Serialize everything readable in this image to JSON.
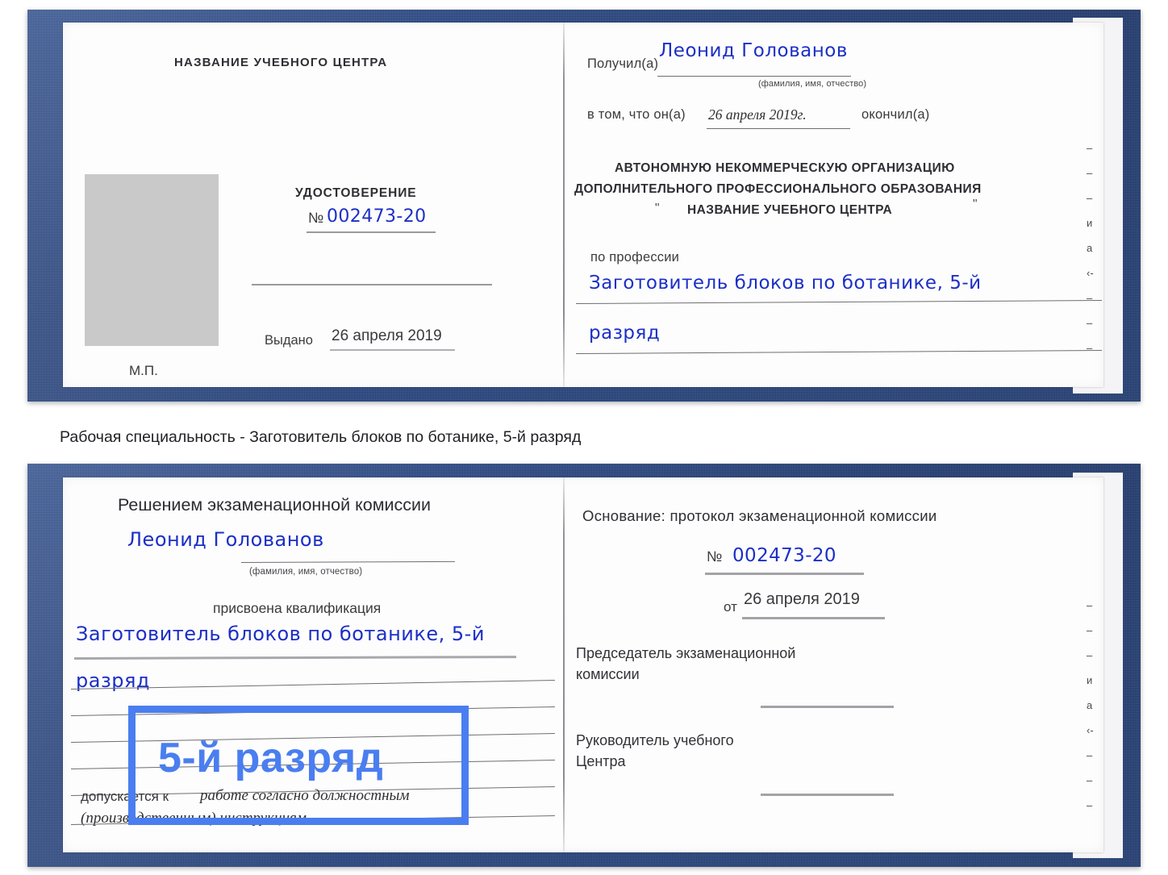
{
  "caption": "Рабочая специальность - Заготовитель блоков по ботанике, 5-й разряд",
  "highlight": {
    "text": "5-й разряд",
    "color": "#4a7ef0"
  },
  "colors": {
    "cover_blue": "#24468a",
    "ink_blue": "#1c2fc6",
    "accent_blue": "#4a7ef0",
    "photo_gray": "#c9c9c9",
    "rule_gray": "#9a9a9e"
  },
  "certificate_top": {
    "left_page": {
      "heading": "НАЗВАНИЕ УЧЕБНОГО ЦЕНТРА",
      "doc_type": "УДОСТОВЕРЕНИЕ",
      "number_symbol": "№",
      "number_value": "002473-20",
      "issued_label": "Выдано",
      "issued_value": "26 апреля 2019",
      "stamp_label": "М.П.",
      "photo_placeholder": "photo-placeholder"
    },
    "right_page": {
      "received_label": "Получил(а)",
      "received_value": "Леонид Голованов",
      "fio_hint": "(фамилия, имя, отчество)",
      "that_label": "в том, что он(а)",
      "that_value": "26 апреля 2019г.",
      "finished_label": "окончил(а)",
      "org_line1": "АВТОНОМНУЮ НЕКОММЕРЧЕСКУЮ ОРГАНИЗАЦИЮ",
      "org_line2": "ДОПОЛНИТЕЛЬНОГО ПРОФЕССИОНАЛЬНОГО ОБРАЗОВАНИЯ",
      "org_quote_open": "\"",
      "org_line3": "НАЗВАНИЕ УЧЕБНОГО ЦЕНТРА",
      "org_quote_close": "\"",
      "profession_label": "по профессии",
      "profession_value_line1": "Заготовитель блоков по ботанике, 5-й",
      "profession_value_line2": "разряд"
    }
  },
  "certificate_bottom": {
    "left_page": {
      "heading": "Решением экзаменационной комиссии",
      "name_value": "Леонид Голованов",
      "fio_hint": "(фамилия, имя, отчество)",
      "qualification_label": "присвоена квалификация",
      "qualification_line1": "Заготовитель блоков по ботанике, 5-й",
      "qualification_line2": "разряд",
      "admit_label": "допускается к",
      "admit_value_line1": "работе согласно должностным",
      "admit_value_line2": "(производственным) инструкциям"
    },
    "right_page": {
      "basis_label": "Основание: протокол экзаменационной комиссии",
      "number_symbol": "№",
      "number_value": "002473-20",
      "date_label": "от",
      "date_value": "26 апреля 2019",
      "chairman_line1": "Председатель экзаменационной",
      "chairman_line2": "комиссии",
      "head_line1": "Руководитель учебного",
      "head_line2": "Центра"
    }
  },
  "edge_marks": {
    "top": [
      "–",
      "–",
      "–",
      "и",
      "а",
      "‹-",
      "–",
      "–",
      "–",
      "–"
    ],
    "bottom": [
      "–",
      "–",
      "–",
      "и",
      "а",
      "‹-",
      "–",
      "–",
      "–",
      "–"
    ]
  }
}
